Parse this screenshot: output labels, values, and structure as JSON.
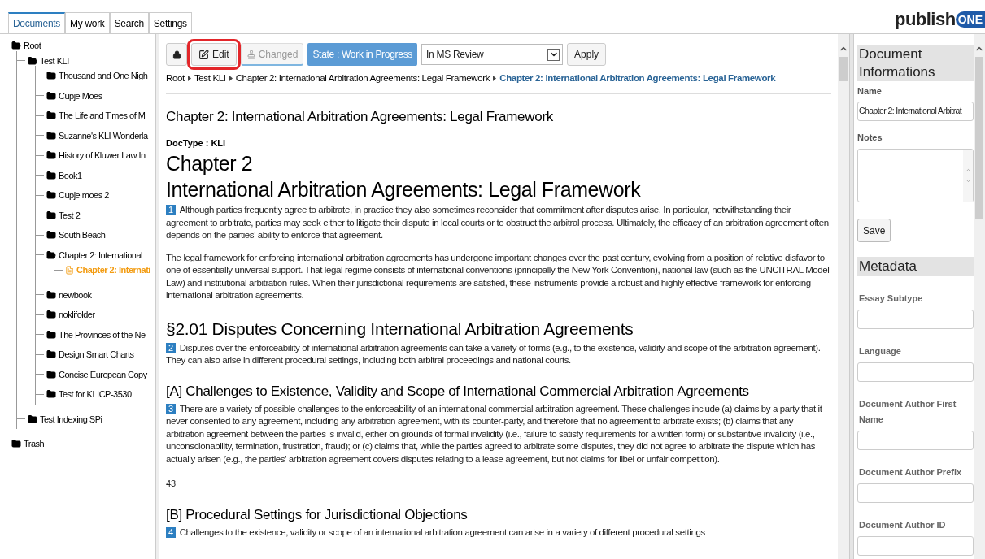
{
  "tabs": [
    {
      "label": "Documents",
      "selected": true
    },
    {
      "label": "My work",
      "selected": false
    },
    {
      "label": "Search",
      "selected": false
    },
    {
      "label": "Settings",
      "selected": false
    }
  ],
  "logo": {
    "text": "publish",
    "badge": "ONE"
  },
  "tree": [
    {
      "label": "Root",
      "kind": "folder",
      "expanded": true,
      "selected": false,
      "children": [
        {
          "label": "Test KLI",
          "kind": "folder",
          "expanded": true,
          "selected": false,
          "children": [
            {
              "label": "Thousand and One Nigh",
              "kind": "folder",
              "expanded": false,
              "selected": false
            },
            {
              "label": "Cupje Moes",
              "kind": "folder",
              "expanded": false,
              "selected": false
            },
            {
              "label": "The Life and Times of M",
              "kind": "folder",
              "expanded": false,
              "selected": false
            },
            {
              "label": "Suzanne's KLI Wonderla",
              "kind": "folder",
              "expanded": false,
              "selected": false
            },
            {
              "label": "History of Kluwer Law In",
              "kind": "folder",
              "expanded": false,
              "selected": false
            },
            {
              "label": "Book1",
              "kind": "folder",
              "expanded": false,
              "selected": false
            },
            {
              "label": "Cupje moes 2",
              "kind": "folder",
              "expanded": false,
              "selected": false
            },
            {
              "label": "Test 2",
              "kind": "folder",
              "expanded": false,
              "selected": false
            },
            {
              "label": "South Beach",
              "kind": "folder",
              "expanded": false,
              "selected": false
            },
            {
              "label": "Chapter 2: International",
              "kind": "folder",
              "expanded": true,
              "selected": false,
              "children": [
                {
                  "label": "Chapter 2: Internati",
                  "kind": "document",
                  "selected": true
                }
              ]
            },
            {
              "label": "newbook",
              "kind": "folder",
              "expanded": false,
              "selected": false
            },
            {
              "label": "noklifolder",
              "kind": "folder",
              "expanded": false,
              "selected": false
            },
            {
              "label": "The Provinces of the Ne",
              "kind": "folder",
              "expanded": false,
              "selected": false
            },
            {
              "label": "Design Smart Charts",
              "kind": "folder",
              "expanded": false,
              "selected": false
            },
            {
              "label": "Concise European Copy",
              "kind": "folder",
              "expanded": false,
              "selected": false
            },
            {
              "label": "Test for KLICP-3530",
              "kind": "folder",
              "expanded": false,
              "selected": false
            }
          ]
        },
        {
          "label": "Test Indexing SPi",
          "kind": "folder",
          "expanded": false,
          "selected": false
        }
      ]
    },
    {
      "label": "Trash",
      "kind": "folder",
      "expanded": false,
      "selected": false
    }
  ],
  "toolbar": {
    "edit": {
      "label": "Edit",
      "highlighted": true
    },
    "changed": {
      "label": "Changed",
      "disabled": true
    },
    "state": "State : Work in Progress",
    "select": "In MS Review",
    "apply": "Apply"
  },
  "breadcrumb": [
    "Root",
    "Test KLI",
    "Chapter 2: International Arbitration Agreements: Legal Framework",
    "Chapter 2: International Arbitration Agreements: Legal Framework"
  ],
  "document": {
    "title": "Chapter 2: International Arbitration Agreements: Legal Framework",
    "doctype": "DocType : KLI",
    "blocks": [
      {
        "kind": "h1",
        "text": "Chapter 2"
      },
      {
        "kind": "h1",
        "text": "International Arbitration Agreements: Legal Framework"
      },
      {
        "kind": "para",
        "number": "1",
        "text": "Although parties frequently agree to arbitrate, in practice they also sometimes reconsider that commitment after disputes arise. In particular, notwithstanding their agreement to arbitrate, parties may seek either to litigate their dispute in local courts or to obstruct the arbitral process. Ultimately, the efficacy of an arbitration agreement often depends on the parties' ability to enforce that agreement."
      },
      {
        "kind": "para",
        "text": "The legal framework for enforcing international arbitration agreements has undergone important changes over the past century, evolving from a position of relative disfavor to one of essentially universal support. That legal regime consists of international conventions (principally the New York Convention), national law (such as the UNCITRAL Model Law) and institutional arbitration rules. When their jurisdictional requirements are satisfied, these instruments provide a robust and highly effective framework for enforcing international arbitration agreements."
      },
      {
        "kind": "h2",
        "text": "§2.01 Disputes Concerning International Arbitration Agreements"
      },
      {
        "kind": "para",
        "number": "2",
        "text": "Disputes over the enforceability of international arbitration agreements can take a variety of forms (e.g., to the existence, validity and scope of the arbitration agreement). They can also arise in different procedural settings, including both arbitral proceedings and national courts."
      },
      {
        "kind": "h3",
        "text": "[A] Challenges to Existence, Validity and Scope of International Commercial Arbitration Agreements"
      },
      {
        "kind": "para",
        "number": "3",
        "text": "There are a variety of possible challenges to the enforceability of an international commercial arbitration agreement. These challenges include (a) claims by a party that it never consented to any agreement, including any arbitration agreement, with its counter-party, and therefore that no agreement to arbitrate exists; (b) claims that any arbitration agreement between the parties is invalid, either on grounds of formal invalidity (i.e., failure to satisfy requirements for a written form) or substantive invalidity (i.e., unconscionability, termination, frustration, fraud); or (c) claims that, while the parties agreed to arbitrate some disputes, they did not agree to arbitrate the dispute which has actually arisen (e.g., the parties' arbitration agreement covers disputes relating to a lease agreement, but not claims for libel or unfair competition)."
      },
      {
        "kind": "page",
        "text": "43"
      },
      {
        "kind": "h3",
        "text": "[B] Procedural Settings for Jurisdictional Objections"
      },
      {
        "kind": "para",
        "number": "4",
        "text": "Challenges to the existence, validity or scope of an international arbitration agreement can arise in a variety of different procedural settings"
      }
    ]
  },
  "info": {
    "title": "Document Informations",
    "name_label": "Name",
    "name_value": "Chapter 2: International Arbitrat",
    "notes_label": "Notes",
    "save": "Save"
  },
  "metadata": {
    "title": "Metadata",
    "fields": [
      "Essay Subtype",
      "Language",
      "Document Author First Name",
      "Document Author Prefix",
      "Document Author ID"
    ]
  }
}
